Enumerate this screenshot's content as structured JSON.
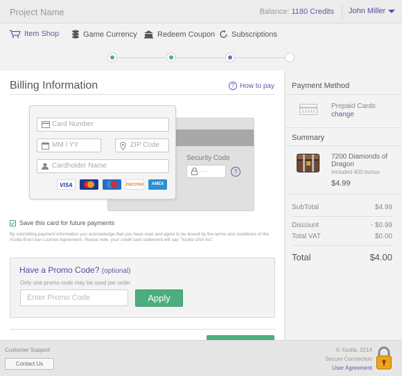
{
  "header": {
    "project_name": "Project Name",
    "balance_label": "Balance:",
    "balance_value": "1180 Credits",
    "user_name": "John Miller"
  },
  "nav": {
    "items": [
      {
        "label": "Item Shop",
        "icon": "cart-icon",
        "active": true
      },
      {
        "label": "Game Currency",
        "icon": "coins-icon",
        "active": false
      },
      {
        "label": "Redeem Coupon",
        "icon": "coupon-icon",
        "active": false
      },
      {
        "label": "Subscriptions",
        "icon": "refresh-icon",
        "active": false
      }
    ]
  },
  "stepper": {
    "steps": [
      {
        "state": "done",
        "color": "#4cae7f"
      },
      {
        "state": "done",
        "color": "#4cae7f"
      },
      {
        "state": "current",
        "color": "#7a66b8"
      },
      {
        "state": "pending",
        "color": "#ffffff"
      }
    ]
  },
  "billing": {
    "title": "Billing Information",
    "how_to_pay": "How to pay",
    "card_number_placeholder": "Card Number",
    "expiry_placeholder": "MM / YY",
    "zip_placeholder": "ZIP Code",
    "cardholder_placeholder": "Cardholder Name",
    "security_code_label": "Security Code",
    "security_code_placeholder": "···",
    "card_logos": [
      {
        "name": "VISA",
        "bg": "#ffffff",
        "fg": "#1a3a8f"
      },
      {
        "name": "MasterCard",
        "bg": "#1a3a8f",
        "fg": "#ffffff"
      },
      {
        "name": "Maestro",
        "bg": "#2b6cc4",
        "fg": "#ffffff"
      },
      {
        "name": "DISCOVER",
        "bg": "#ffffff",
        "fg": "#e07a1f"
      },
      {
        "name": "AMEX",
        "bg": "#2a8fd6",
        "fg": "#ffffff"
      }
    ],
    "save_card_label": "Save this card for future payments",
    "legal_text": "By submitting payment information you acknowledge that you have read and agree to be bound by the terms and conditions of the Xsolla End User License Agreement. Please note, your credit card statement will say \"Xsolla USA Inc\"."
  },
  "promo": {
    "title": "Have a Promo Code?",
    "optional": "(optional)",
    "note": "Only one promo code may be used per order",
    "placeholder": "Enter Promo Code",
    "apply_label": "Apply"
  },
  "sidebar": {
    "payment_method_title": "Payment Method",
    "payment_method_name": "Prepaid Cards",
    "change_label": "change",
    "summary_title": "Summary",
    "item_name": "7200 Diamonds of Dragon",
    "item_bonus": "Included 400 bonus",
    "item_price": "$4.99",
    "subtotal_label": "SubTotal",
    "subtotal_value": "$4.99",
    "discount_label": "Discount",
    "discount_value": "- $0.99",
    "vat_label": "Total VAT",
    "vat_value": "$0.00",
    "total_label": "Total",
    "total_value": "$4.00"
  },
  "footer": {
    "support_label": "Customer Support",
    "contact_label": "Contact Us",
    "copyright": "© Xsolla, 2014",
    "secure": "Secure Connection",
    "agreement": "User Agreement"
  },
  "colors": {
    "accent": "#6a54a8",
    "success": "#4cae7f"
  }
}
